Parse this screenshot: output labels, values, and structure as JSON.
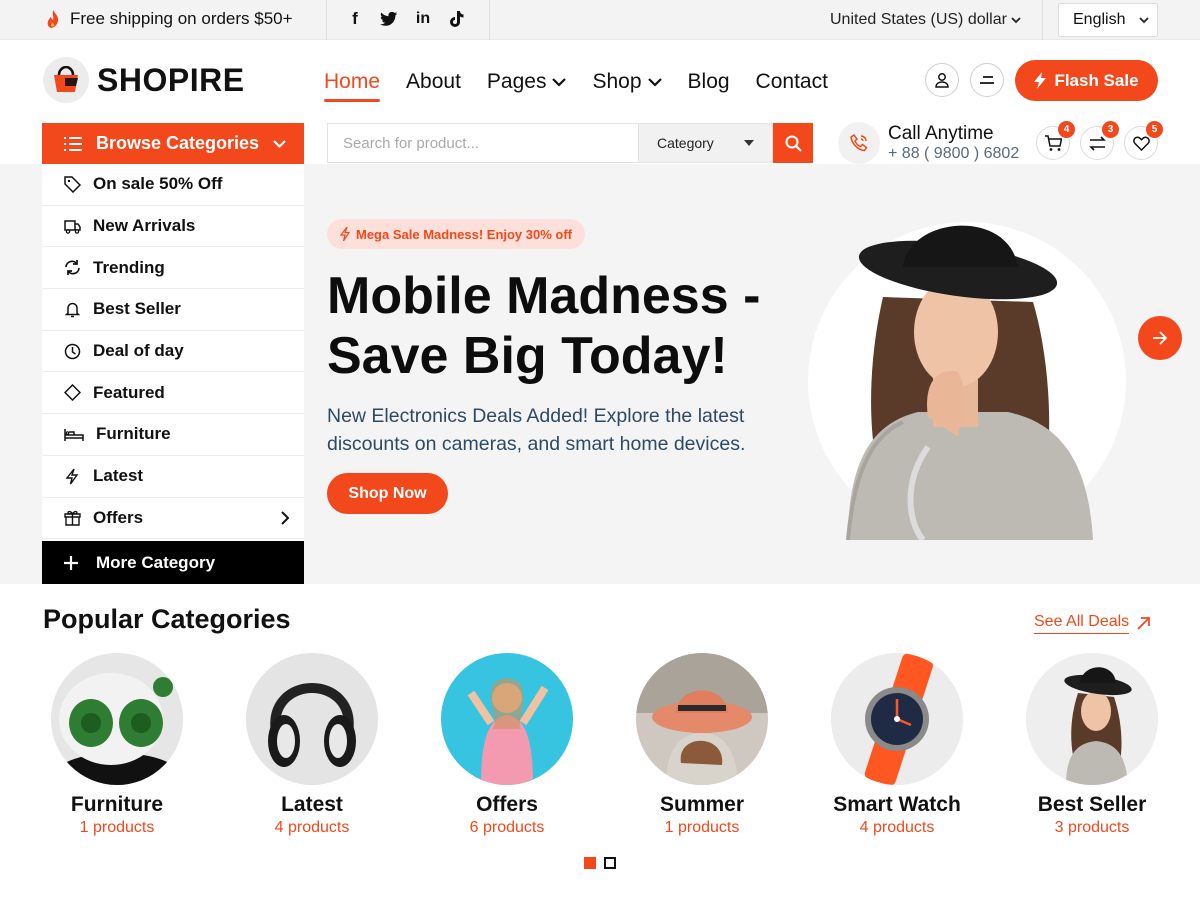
{
  "topbar": {
    "promo": "Free shipping on orders $50+",
    "social": [
      "facebook-icon",
      "twitter-icon",
      "linkedin-icon",
      "tiktok-icon"
    ],
    "currency": "United States (US) dollar",
    "language": "English"
  },
  "brand": {
    "name": "SHOPIRE",
    "accent": "#f2481b"
  },
  "nav": [
    {
      "label": "Home",
      "active": true,
      "dropdown": false
    },
    {
      "label": "About",
      "active": false,
      "dropdown": false
    },
    {
      "label": "Pages",
      "active": false,
      "dropdown": true
    },
    {
      "label": "Shop",
      "active": false,
      "dropdown": true
    },
    {
      "label": "Blog",
      "active": false,
      "dropdown": false
    },
    {
      "label": "Contact",
      "active": false,
      "dropdown": false
    }
  ],
  "header": {
    "flash_sale": "Flash Sale"
  },
  "browse": {
    "label": "Browse Categories"
  },
  "search": {
    "placeholder": "Search for product...",
    "category": "Category"
  },
  "call": {
    "title": "Call Anytime",
    "phone": "+ 88 ( 9800 ) 6802"
  },
  "badges": {
    "cart": "4",
    "compare": "3",
    "wishlist": "5"
  },
  "side_menu": [
    {
      "label": "On sale 50% Off",
      "icon": "tag-icon"
    },
    {
      "label": "New Arrivals",
      "icon": "truck-icon"
    },
    {
      "label": "Trending",
      "icon": "refresh-icon"
    },
    {
      "label": "Best Seller",
      "icon": "bell-icon"
    },
    {
      "label": "Deal of day",
      "icon": "clock-icon"
    },
    {
      "label": "Featured",
      "icon": "diamond-icon"
    },
    {
      "label": "Furniture",
      "icon": "bed-icon"
    },
    {
      "label": "Latest",
      "icon": "bolt-icon"
    },
    {
      "label": "Offers",
      "icon": "gift-icon"
    }
  ],
  "more_category": "More Category",
  "hero": {
    "pill": "Mega Sale Madness! Enjoy 30% off",
    "title": "Mobile Madness - Save Big Today!",
    "description": "New Electronics Deals Added! Explore the latest discounts on cameras, and smart home devices.",
    "cta": "Shop Now"
  },
  "popular": {
    "title": "Popular Categories",
    "see_all": "See All Deals",
    "items": [
      {
        "name": "Furniture",
        "count": "1 products"
      },
      {
        "name": "Latest",
        "count": "4 products"
      },
      {
        "name": "Offers",
        "count": "6 products"
      },
      {
        "name": "Summer",
        "count": "1 products"
      },
      {
        "name": "Smart Watch",
        "count": "4 products"
      },
      {
        "name": "Best Seller",
        "count": "3 products"
      }
    ]
  },
  "pagination": {
    "pages": 2,
    "active": 1
  }
}
